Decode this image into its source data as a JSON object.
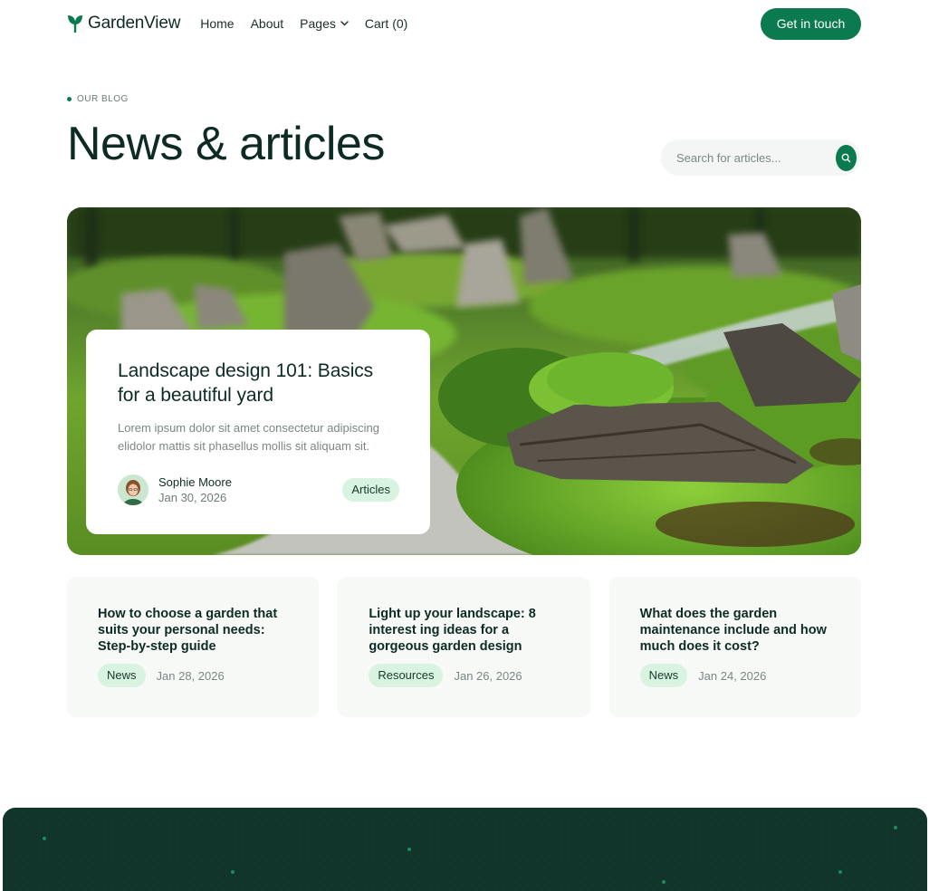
{
  "nav": {
    "brand": "GardenView",
    "links": [
      {
        "label": "Home"
      },
      {
        "label": "About"
      },
      {
        "label": "Pages"
      },
      {
        "label": "Cart (0)"
      }
    ],
    "cta": "Get in touch",
    "icons": {
      "logo": "leaf-logo-icon",
      "pages_dropdown": "chevron-down-icon"
    }
  },
  "header": {
    "eyebrow": "OUR BLOG",
    "title": "News & articles",
    "search_placeholder": "Search for articles...",
    "search_icon": "search-icon"
  },
  "featured": {
    "title": "Landscape design 101: Basics for a beautiful yard",
    "excerpt": "Lorem ipsum dolor sit amet consectetur adipiscing elidolor mattis sit phasellus mollis sit aliquam sit.",
    "author": "Sophie Moore",
    "date": "Jan 30, 2026",
    "tag": "Articles"
  },
  "posts": [
    {
      "title": "How to choose a garden that suits your personal needs: Step-by-step guide",
      "tag": "News",
      "date": "Jan 28, 2026"
    },
    {
      "title": "Light up your landscape: 8 interest ing ideas for a gorgeous garden design",
      "tag": "Resources",
      "date": "Jan 26, 2026"
    },
    {
      "title": "What does the garden maintenance include and how much does it cost?",
      "tag": "News",
      "date": "Jan 24, 2026"
    }
  ],
  "colors": {
    "brand": "#0c7a4f",
    "dark": "#0d2b24",
    "tag_bg": "#d8f3df",
    "footer_bg": "#11352b"
  }
}
